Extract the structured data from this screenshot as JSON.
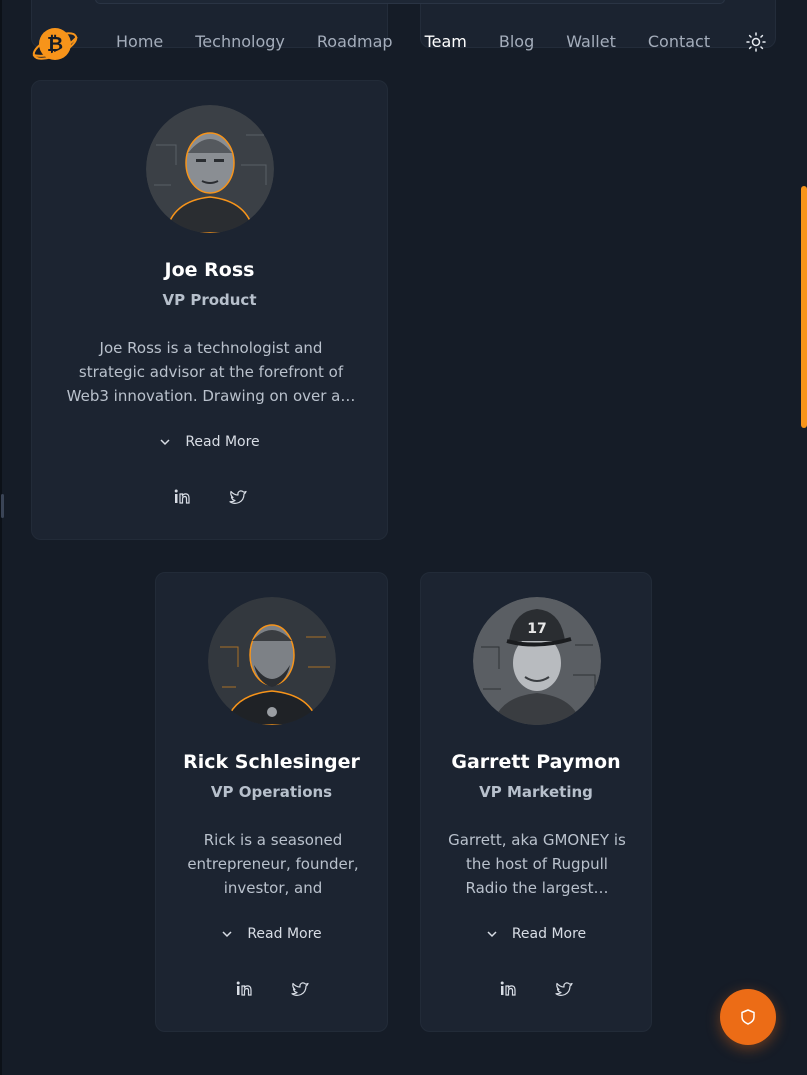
{
  "header": {
    "nav": [
      {
        "label": "Home"
      },
      {
        "label": "Technology"
      },
      {
        "label": "Roadmap"
      },
      {
        "label": "Team"
      },
      {
        "label": "Blog"
      },
      {
        "label": "Wallet"
      },
      {
        "label": "Contact"
      }
    ],
    "active_nav": "Team",
    "logo_icon": "bitcoin-planet-logo",
    "theme_icon": "sun-icon"
  },
  "team": [
    {
      "name": "Joe Ross",
      "role": "VP Product",
      "bio": "Joe Ross is a technologist and strategic advisor at the forefront of Web3 innovation. Drawing on over a…",
      "read_more": "Read More"
    },
    {
      "name": "Rick Schlesinger",
      "role": "VP Operations",
      "bio": "Rick is a seasoned entrepreneur, founder, investor, and strategic…",
      "read_more": "Read More"
    },
    {
      "name": "Garrett Paymon",
      "role": "VP Marketing",
      "bio": "Garrett, aka GMONEY is the host of Rugpull Radio the largest…",
      "read_more": "Read More"
    }
  ],
  "colors": {
    "accent": "#f7941a",
    "background": "#151c27",
    "card": "#1c2431",
    "fab": "#ec6c16"
  },
  "fab_icon": "shield-icon"
}
